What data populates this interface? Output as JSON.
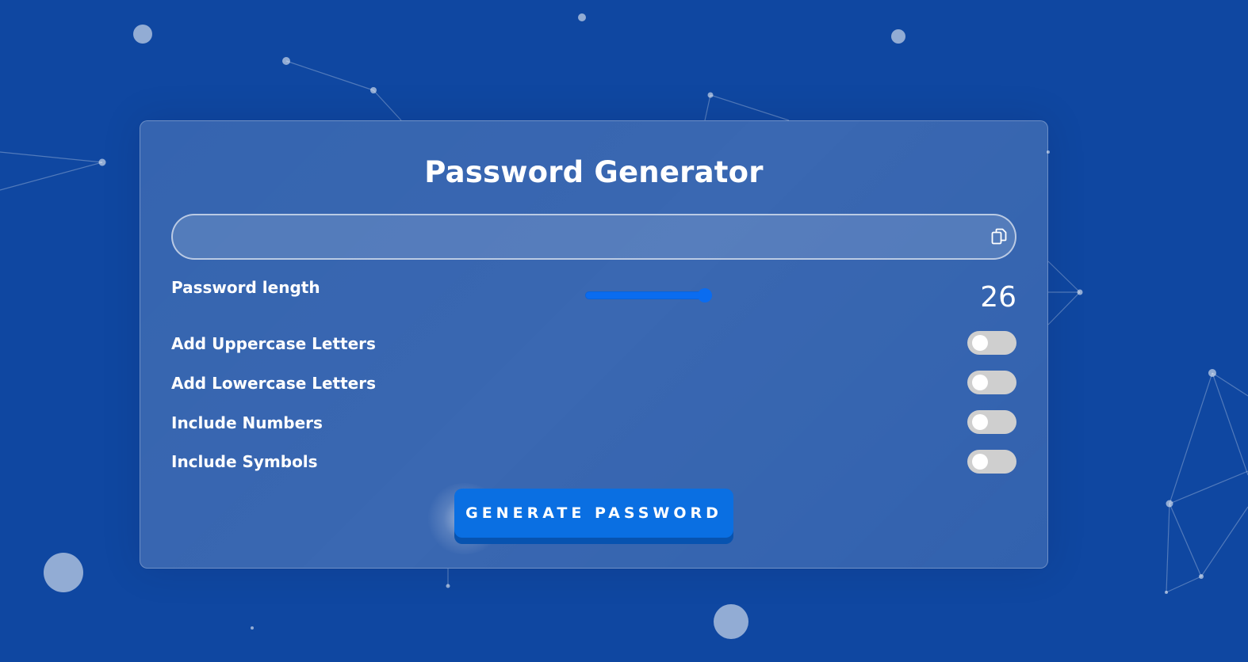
{
  "app": {
    "title": "Password Generator"
  },
  "password_field": {
    "value": "",
    "copy_icon": "copy-icon"
  },
  "length": {
    "label": "Password length",
    "value": "26",
    "slider_fraction": 1.0
  },
  "options": [
    {
      "label": "Add Uppercase Letters",
      "enabled": false
    },
    {
      "label": "Add Lowercase Letters",
      "enabled": false
    },
    {
      "label": "Include Numbers",
      "enabled": false
    },
    {
      "label": "Include Symbols",
      "enabled": false
    }
  ],
  "generate_button": {
    "label": "GENERATE PASSWORD"
  },
  "colors": {
    "background": "#0f47a1",
    "accent": "#0a6fe2",
    "toggle_off": "#cfcfcf"
  }
}
